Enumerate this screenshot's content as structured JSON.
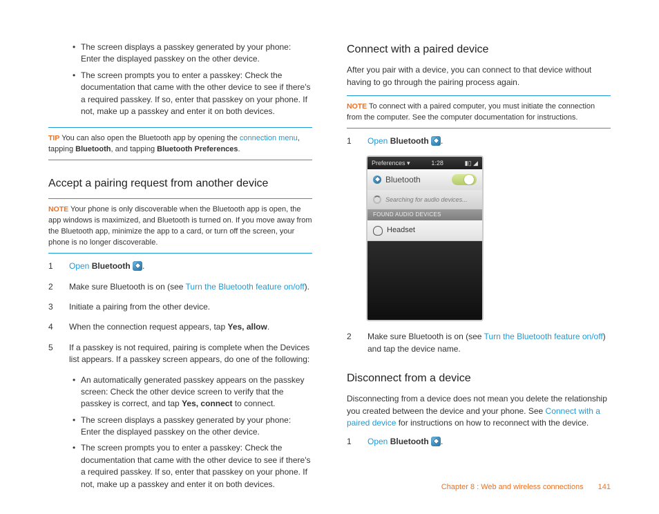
{
  "left": {
    "intro_bullets": [
      "The screen displays a passkey generated by your phone: Enter the displayed passkey on the other device.",
      "The screen prompts you to enter a passkey: Check the documentation that came with the other device to see if there's a required passkey. If so, enter that passkey on your phone. If not, make up a passkey and enter it on both devices."
    ],
    "tip": {
      "label": "TIP",
      "pre": " You can also open the Bluetooth app by opening the ",
      "link": "connection menu",
      "mid": ", tapping ",
      "b1": "Bluetooth",
      "mid2": ", and tapping ",
      "b2": "Bluetooth Preferences",
      "post": "."
    },
    "h_accept": "Accept a pairing request from another device",
    "note": {
      "label": "NOTE",
      "text": " Your phone is only discoverable when the Bluetooth app is open, the app windows is maximized, and Bluetooth is turned on. If you move away from the Bluetooth app, minimize the app to a card, or turn off the screen, your phone is no longer discoverable."
    },
    "steps": [
      {
        "n": "1",
        "open": "Open",
        "bold": "Bluetooth",
        "hasIcon": true
      },
      {
        "n": "2",
        "pre": "Make sure Bluetooth is on (see ",
        "link": "Turn the Bluetooth feature on/off",
        "post": ")."
      },
      {
        "n": "3",
        "plain": "Initiate a pairing from the other device."
      },
      {
        "n": "4",
        "pre": "When the connection request appears, tap ",
        "bold": "Yes, allow",
        "post": "."
      },
      {
        "n": "5",
        "plain": "If a passkey is not required, pairing is complete when the Devices list appears. If a passkey screen appears, do one of the following:"
      }
    ],
    "step_bullets": [
      {
        "pre": "An automatically generated passkey appears on the passkey screen: Check the other device screen to verify that the passkey is correct, and tap ",
        "bold": "Yes, connect",
        "post": " to connect."
      },
      {
        "plain": "The screen displays a passkey generated by your phone: Enter the displayed passkey on the other device."
      },
      {
        "plain": "The screen prompts you to enter a passkey: Check the documentation that came with the other device to see if there's a required passkey. If so, enter that passkey on your phone. If not, make up a passkey and enter it on both devices."
      }
    ]
  },
  "right": {
    "h_connect": "Connect with a paired device",
    "p_connect": "After you pair with a device, you can connect to that device without having to go through the pairing process again.",
    "note": {
      "label": "NOTE",
      "text": " To connect with a paired computer, you must initiate the connection from the computer. See the computer documentation for instructions."
    },
    "step1": {
      "n": "1",
      "open": "Open",
      "bold": "Bluetooth"
    },
    "phone": {
      "status_left": "Preferences",
      "status_time": "1:28",
      "title": "Bluetooth",
      "toggle": "ON",
      "searching": "Searching for audio devices...",
      "section": "FOUND AUDIO DEVICES",
      "row1": "Headset"
    },
    "step2": {
      "n": "2",
      "pre": "Make sure Bluetooth is on (see ",
      "link": "Turn the Bluetooth feature on/off",
      "post": ") and tap the device name."
    },
    "h_disc": "Disconnect from a device",
    "p_disc_pre": "Disconnecting from a device does not mean you delete the relationship you created between the device and your phone. See ",
    "p_disc_link": "Connect with a paired device",
    "p_disc_post": " for instructions on how to reconnect with the device.",
    "step3": {
      "n": "1",
      "open": "Open",
      "bold": "Bluetooth"
    }
  },
  "footer": {
    "chapter": "Chapter 8 : Web and wireless connections",
    "page": "141"
  }
}
